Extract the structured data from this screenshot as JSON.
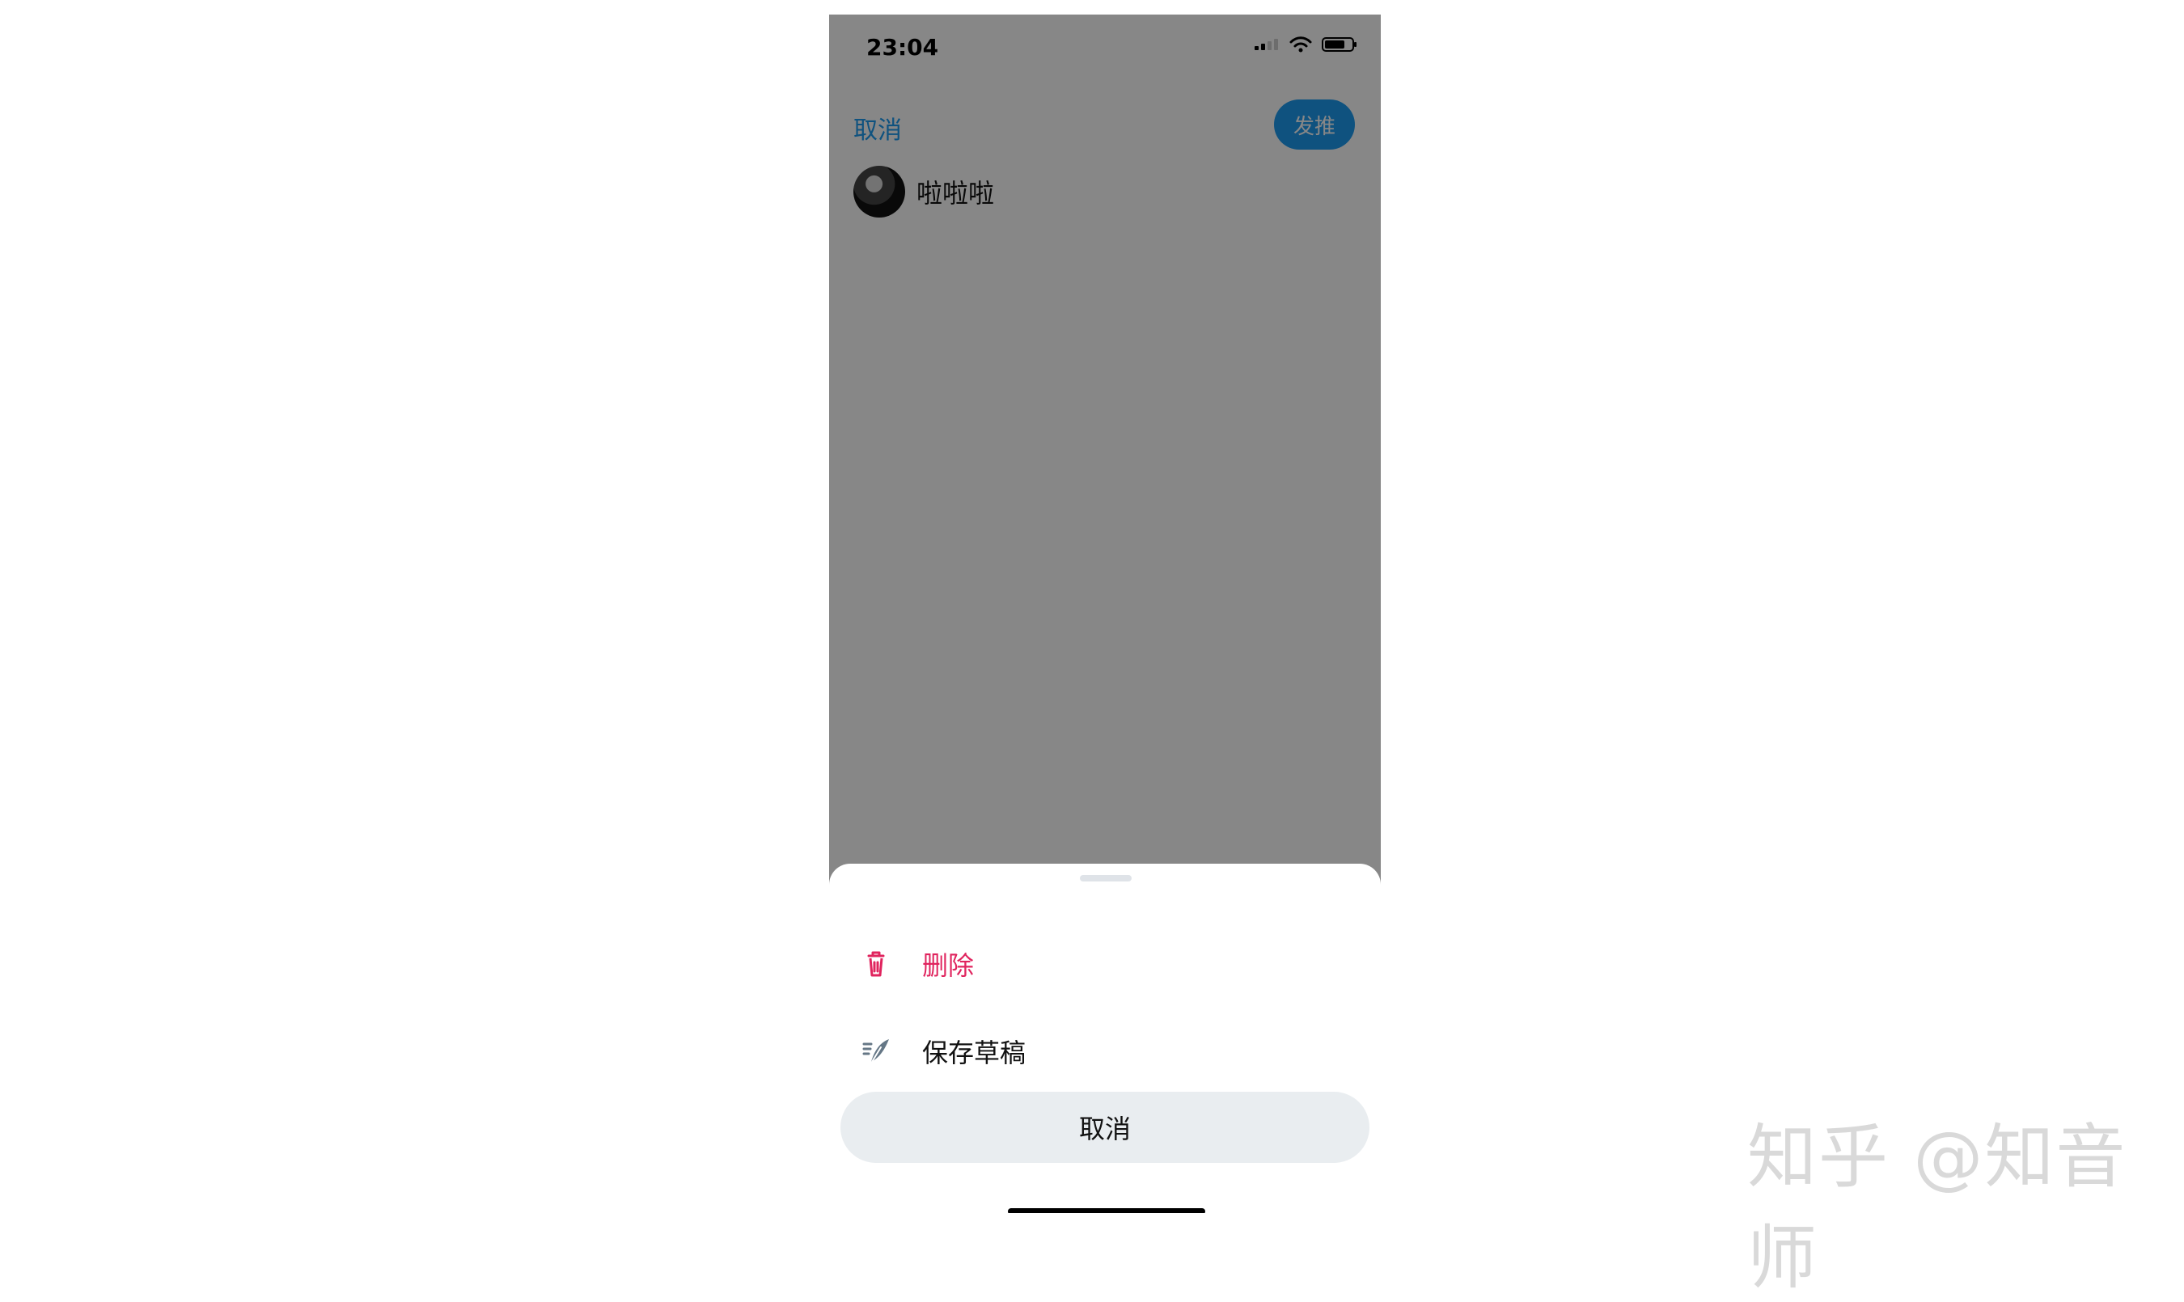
{
  "status_bar": {
    "time": "23:04",
    "signal_icon": "cellular-signal-icon",
    "wifi_icon": "wifi-icon",
    "battery_icon": "battery-icon"
  },
  "compose": {
    "cancel_label": "取消",
    "tweet_button_label": "发推",
    "draft_text": "啦啦啦",
    "avatar_icon": "avatar"
  },
  "action_sheet": {
    "items": [
      {
        "label": "删除",
        "icon": "trash-icon",
        "color": "#e0245e"
      },
      {
        "label": "保存草稿",
        "icon": "feather-icon",
        "color": "#111111"
      }
    ],
    "cancel_label": "取消"
  },
  "watermark": {
    "text": "知乎 @知音师"
  },
  "colors": {
    "accent": "#1d9bf0",
    "danger": "#e0245e",
    "overlay": "rgba(0,0,0,0.47)",
    "sheet_cancel_bg": "#e9edf0"
  }
}
